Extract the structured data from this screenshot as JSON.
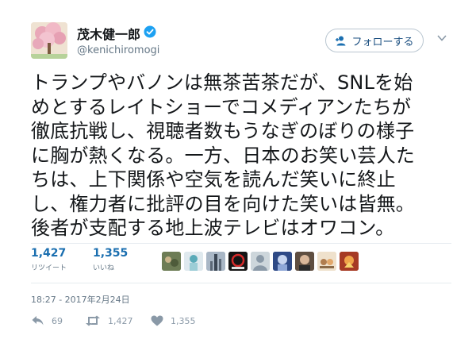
{
  "user": {
    "display_name": "茂木健一郎",
    "handle": "@kenichiromogi",
    "verified": true
  },
  "follow_button": {
    "label": "フォローする"
  },
  "tweet_lines": [
    "トランプやバノンは無茶苦茶だが、SNLを始",
    "めとするレイトショーでコメディアンたちが",
    "徹底抗戦し、視聴者数もうなぎのぼりの様子",
    "に胸が熱くなる。一方、日本のお笑い芸人た",
    "ちは、上下関係や空気を読んだ笑いに終止",
    "し、権力者に批評の目を向けた笑いは皆無。",
    "後者が支配する地上波テレビはオワコン。"
  ],
  "stats": {
    "retweets": {
      "count": "1,427",
      "label": "リツイート"
    },
    "likes": {
      "count": "1,355",
      "label": "いいね"
    }
  },
  "likers_icons": [
    "liker-avatar",
    "liker-avatar",
    "liker-avatar",
    "liker-avatar",
    "liker-avatar",
    "liker-avatar",
    "liker-avatar",
    "liker-avatar",
    "liker-avatar"
  ],
  "timestamp": "18:27 - 2017年2月24日",
  "actions": {
    "reply": {
      "icon": "reply-icon",
      "count": "69"
    },
    "retweet": {
      "icon": "retweet-icon",
      "count": "1,427"
    },
    "like": {
      "icon": "heart-icon",
      "count": "1,355"
    }
  },
  "colors": {
    "link": "#1b6fb0",
    "verified": "#1da1f2",
    "muted": "#657786"
  }
}
